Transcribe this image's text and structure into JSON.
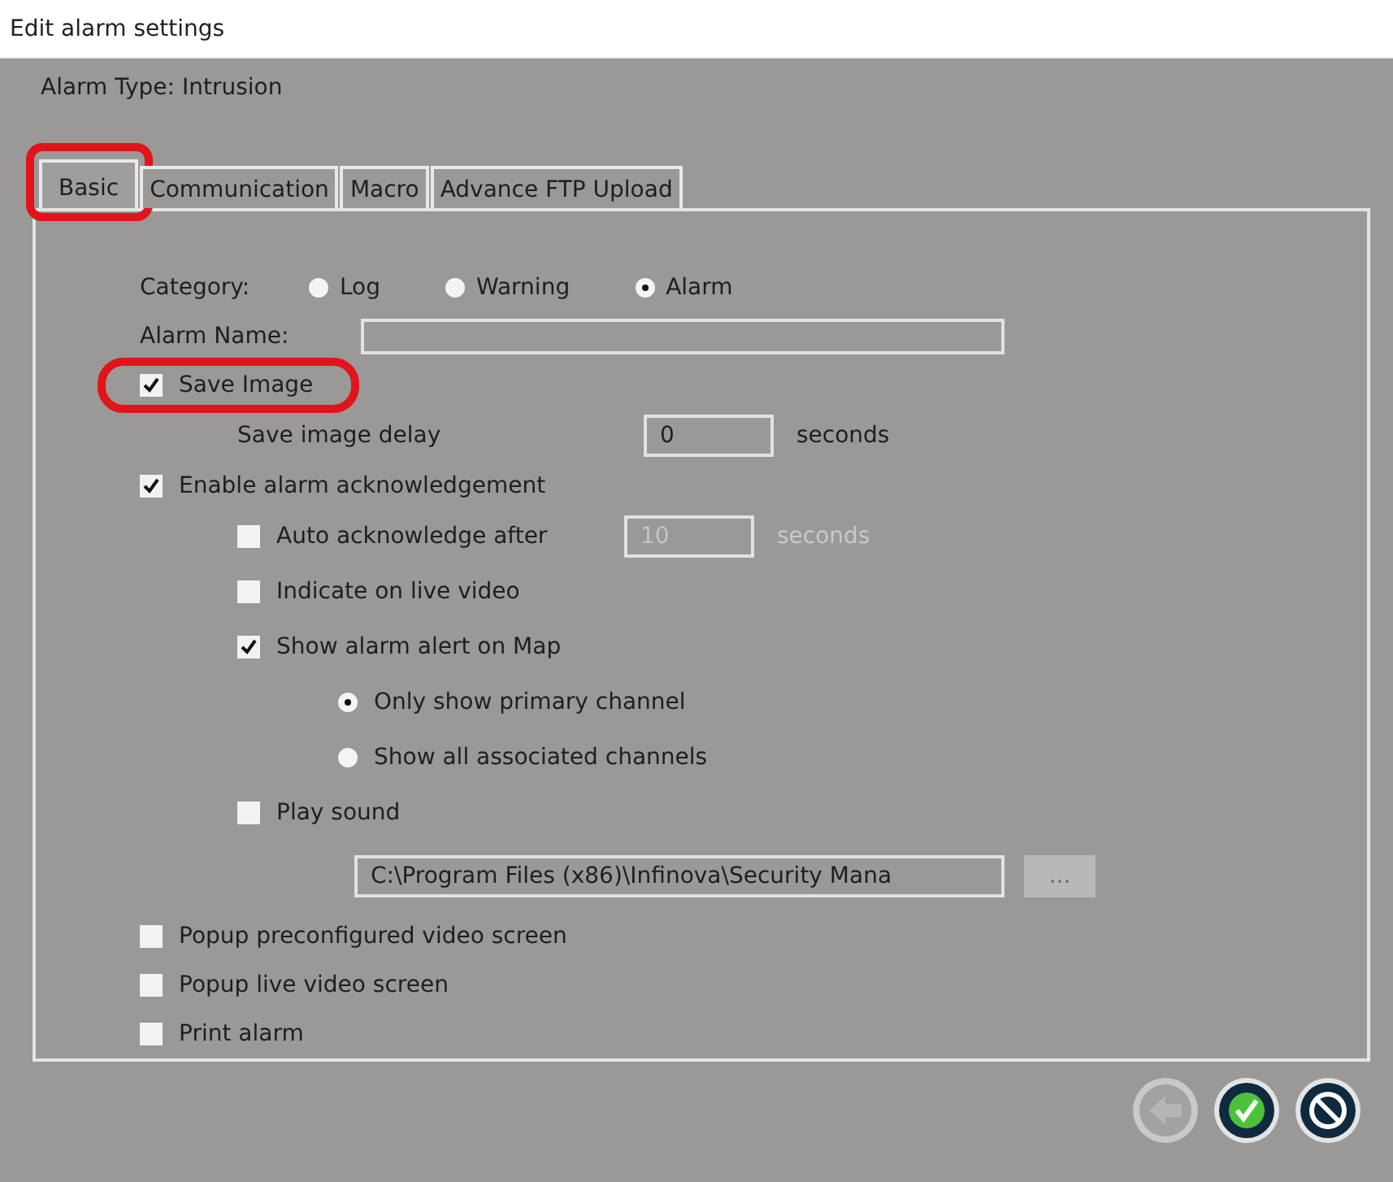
{
  "window": {
    "title": "Edit alarm settings"
  },
  "alarm_type": "Alarm Type: Intrusion",
  "tabs": [
    {
      "label": "Basic",
      "selected": true,
      "highlighted": true
    },
    {
      "label": "Communication",
      "selected": false,
      "highlighted": false
    },
    {
      "label": "Macro",
      "selected": false,
      "highlighted": false
    },
    {
      "label": "Advance FTP Upload",
      "selected": false,
      "highlighted": false
    }
  ],
  "category": {
    "label": "Category:",
    "options": [
      {
        "label": "Log",
        "selected": false
      },
      {
        "label": "Warning",
        "selected": false
      },
      {
        "label": "Alarm",
        "selected": true
      }
    ]
  },
  "alarm_name": {
    "label": "Alarm Name:"
  },
  "items": [
    {
      "kind": "checkbox",
      "label": "Save Image",
      "checked": true,
      "highlighted": true,
      "children": [
        {
          "kind": "field",
          "label": "Save image delay",
          "field": {
            "value": "0",
            "unit": "seconds",
            "disabled": false
          }
        }
      ]
    },
    {
      "kind": "checkbox",
      "label": "Enable alarm acknowledgement",
      "checked": true,
      "highlighted": false,
      "children": [
        {
          "kind": "checkbox",
          "label": "Auto acknowledge after",
          "checked": false,
          "highlighted": false,
          "field": {
            "value": "10",
            "unit": "seconds",
            "disabled": true
          }
        },
        {
          "kind": "checkbox",
          "label": "Indicate on live video",
          "checked": false,
          "highlighted": false
        },
        {
          "kind": "checkbox",
          "label": "Show alarm alert on Map",
          "checked": true,
          "highlighted": false,
          "children": [
            {
              "kind": "radio",
              "label": "Only show primary channel",
              "selected": true
            },
            {
              "kind": "radio",
              "label": "Show all associated channels",
              "selected": false
            }
          ]
        },
        {
          "kind": "checkbox",
          "label": "Play sound",
          "checked": false,
          "highlighted": false,
          "children": [
            {
              "kind": "path",
              "value": "C:\\Program Files (x86)\\Infinova\\Security Mana",
              "browse": {
                "label": "...",
                "disabled": true
              }
            }
          ]
        }
      ]
    },
    {
      "kind": "checkbox",
      "label": "Popup preconfigured video screen",
      "checked": false,
      "highlighted": false
    },
    {
      "kind": "checkbox",
      "label": "Popup live video screen",
      "checked": false,
      "highlighted": false
    },
    {
      "kind": "checkbox",
      "label": "Print alarm",
      "checked": false,
      "highlighted": false
    }
  ],
  "buttons": [
    {
      "kind": "back",
      "disabled": true
    },
    {
      "kind": "ok",
      "disabled": false
    },
    {
      "kind": "cancel",
      "disabled": false
    }
  ]
}
